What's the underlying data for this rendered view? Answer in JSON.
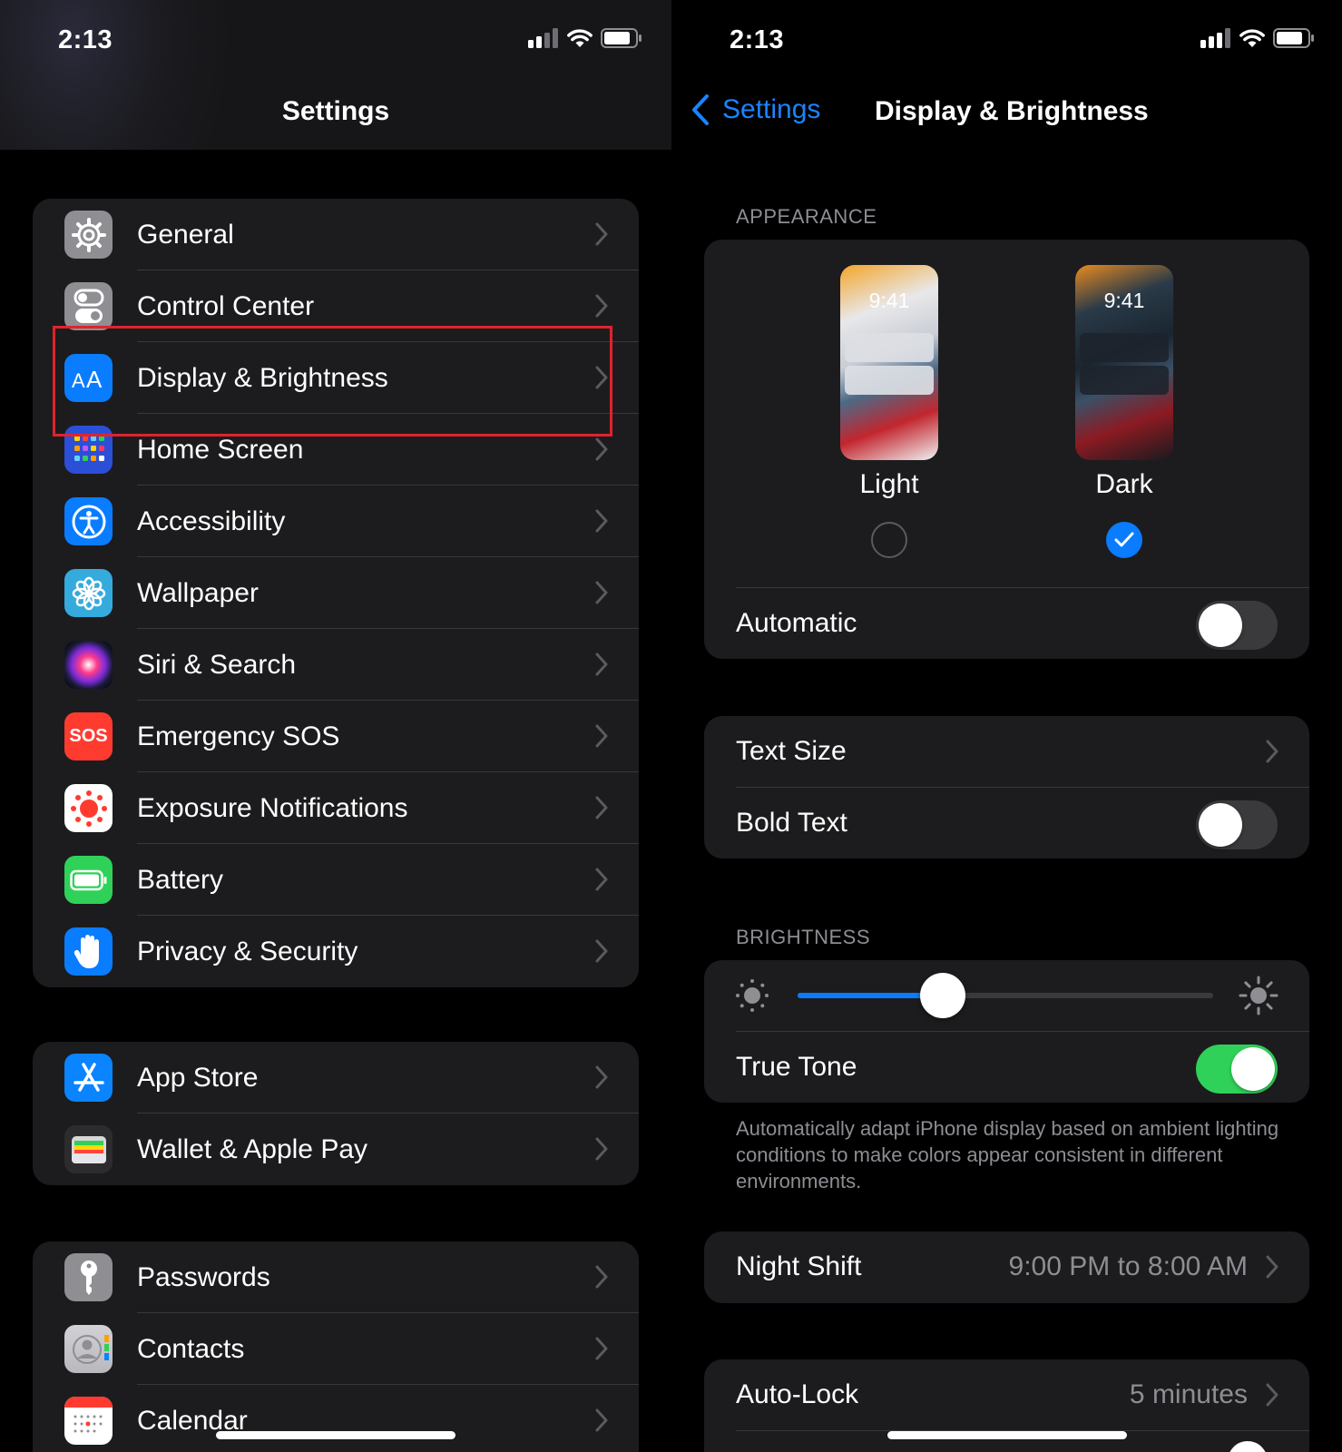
{
  "left_panel": {
    "status": {
      "time": "2:13"
    },
    "nav_title": "Settings",
    "groups": [
      [
        {
          "label": "General",
          "icon": "gear-icon"
        },
        {
          "label": "Control Center",
          "icon": "switches-icon"
        },
        {
          "label": "Display & Brightness",
          "icon": "text-size-icon"
        },
        {
          "label": "Home Screen",
          "icon": "app-grid-icon"
        },
        {
          "label": "Accessibility",
          "icon": "accessibility-icon"
        },
        {
          "label": "Wallpaper",
          "icon": "flower-icon"
        },
        {
          "label": "Siri & Search",
          "icon": "siri-icon"
        },
        {
          "label": "Emergency SOS",
          "icon": "sos-icon",
          "icon_text": "SOS"
        },
        {
          "label": "Exposure Notifications",
          "icon": "exposure-icon"
        },
        {
          "label": "Battery",
          "icon": "battery-icon"
        },
        {
          "label": "Privacy & Security",
          "icon": "hand-icon"
        }
      ],
      [
        {
          "label": "App Store",
          "icon": "app-store-icon"
        },
        {
          "label": "Wallet & Apple Pay",
          "icon": "wallet-icon"
        }
      ],
      [
        {
          "label": "Passwords",
          "icon": "key-icon"
        },
        {
          "label": "Contacts",
          "icon": "contacts-icon"
        },
        {
          "label": "Calendar",
          "icon": "calendar-icon"
        }
      ]
    ],
    "highlighted_item": "Display & Brightness"
  },
  "right_panel": {
    "status": {
      "time": "2:13"
    },
    "back_label": "Settings",
    "nav_title": "Display & Brightness",
    "appearance": {
      "header": "APPEARANCE",
      "options": [
        {
          "label": "Light",
          "preview_time": "9:41",
          "selected": false
        },
        {
          "label": "Dark",
          "preview_time": "9:41",
          "selected": true
        }
      ],
      "automatic_label": "Automatic",
      "automatic_on": false
    },
    "text": {
      "text_size_label": "Text Size",
      "bold_text_label": "Bold Text",
      "bold_text_on": false
    },
    "brightness": {
      "header": "BRIGHTNESS",
      "level": 0.35,
      "true_tone_label": "True Tone",
      "true_tone_on": true,
      "description": "Automatically adapt iPhone display based on ambient lighting conditions to make colors appear consistent in different environments."
    },
    "night_shift": {
      "label": "Night Shift",
      "value": "9:00 PM to 8:00 AM"
    },
    "auto_lock": {
      "label": "Auto-Lock",
      "value": "5 minutes"
    }
  },
  "colors": {
    "accent": "#1a84ff",
    "toggle_on": "#30d158",
    "highlight_box": "#e0232b",
    "cell_bg": "#1c1c1e"
  }
}
